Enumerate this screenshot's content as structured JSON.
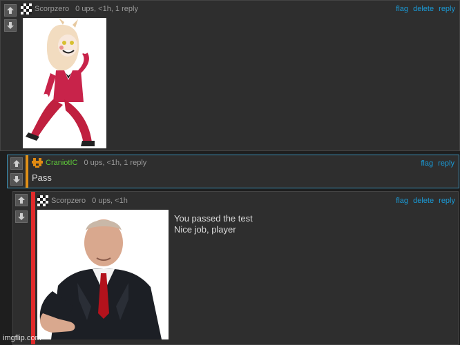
{
  "comment1": {
    "username": "Scorpzero",
    "stats": "0 ups, <1h, 1 reply",
    "actions": [
      "flag",
      "delete",
      "reply"
    ],
    "image_alt": "cartoon character in red suit"
  },
  "comment2": {
    "username": "CraniotIC",
    "stats": "0 ups, <1h, 1 reply",
    "actions": [
      "flag",
      "reply"
    ],
    "text": "Pass"
  },
  "comment3": {
    "username": "Scorpzero",
    "stats": "0 ups, <1h",
    "actions": [
      "flag",
      "delete",
      "reply"
    ],
    "text_line1": "You passed the test",
    "text_line2": "Nice job, player"
  },
  "watermark": "imgflip.com",
  "colors": {
    "link": "#1a9ad6",
    "username_green": "#5ec93a",
    "reply_accent_orange": "#e09018",
    "reply_accent_red": "#e02a2a",
    "highlight_border": "#3a8fb5"
  }
}
